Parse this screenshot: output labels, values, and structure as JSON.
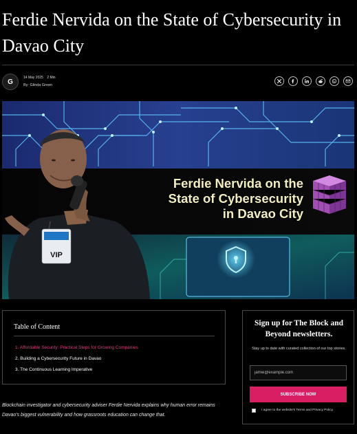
{
  "article": {
    "title": "Ferdie Nervida on the State of Cybersecurity in Davao City",
    "author_initial": "G",
    "date": "14 May 2025",
    "read_time": "2 Min",
    "byline": "By: Glinda Green"
  },
  "share": {
    "icons": [
      "x-icon",
      "facebook-icon",
      "linkedin-icon",
      "reddit-icon",
      "whatsapp-icon",
      "email-icon"
    ]
  },
  "hero": {
    "title": "Ferdie Nervida on the\nState of Cybersecurity\nin Davao City",
    "badge": "VIP",
    "colors": {
      "title": "#f3eec0",
      "circuit": "#4fb6ff",
      "cube": "#c06dcf"
    }
  },
  "toc": {
    "heading": "Table of Content",
    "items": [
      {
        "label": "1. Affordable Security: Practical Steps for Growing Companies",
        "active": true
      },
      {
        "label": "2. Building a Cybersecurity Future in Davao",
        "active": false
      },
      {
        "label": "3. The Continuous Learning Imperative",
        "active": false
      }
    ]
  },
  "intro": "Blockchain investigator and cybersecurity adviser Ferdie Nervida explains why human error remains Davao's biggest vulnerability and how grassroots education can change that.",
  "newsletter": {
    "heading": "Sign up for The Block and Beyond newsletters.",
    "subtext": "Stay up to date with curated collection of our top stories.",
    "email_placeholder": "jamie@example.com",
    "button_label": "SUBSCRIBE NOW",
    "agree_text": "I agree to the website's Terms and Privacy Policy."
  },
  "colors": {
    "accent": "#d91e63",
    "toc_active": "#e6397e",
    "background": "#000000"
  }
}
